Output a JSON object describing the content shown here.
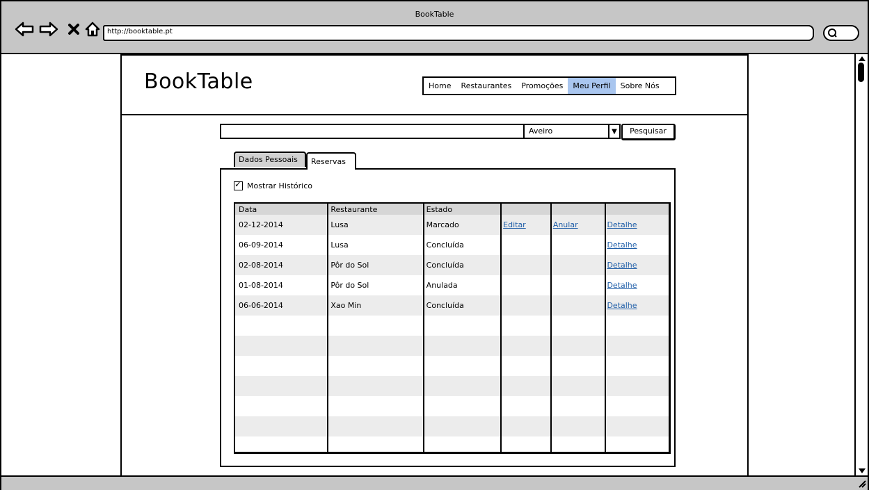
{
  "browser": {
    "window_title": "BookTable",
    "url": "http://booktable.pt"
  },
  "header": {
    "logo": "BookTable",
    "nav": [
      "Home",
      "Restaurantes",
      "Promoções",
      "Meu Perfil",
      "Sobre Nós"
    ],
    "active_nav": "Meu Perfil"
  },
  "search": {
    "query": "",
    "city": "Aveiro",
    "button": "Pesquisar"
  },
  "tabs": [
    "Dados Pessoais",
    "Reservas"
  ],
  "active_tab": "Reservas",
  "history_checkbox": {
    "label": "Mostrar Histórico",
    "checked": true
  },
  "table": {
    "columns": [
      "Data",
      "Restaurante",
      "Estado",
      "",
      "",
      ""
    ],
    "rows": [
      [
        "02-12-2014",
        "Lusa",
        "Marcado",
        "Editar",
        "Anular",
        "Detalhe"
      ],
      [
        "06-09-2014",
        "Lusa",
        "Concluída",
        "",
        "",
        "Detalhe"
      ],
      [
        "02-08-2014",
        "Pôr do Sol",
        "Concluída",
        "",
        "",
        "Detalhe"
      ],
      [
        "01-08-2014",
        "Pôr do Sol",
        "Anulada",
        "",
        "",
        "Detalhe"
      ],
      [
        "06-06-2014",
        "Xao Min",
        "Concluída",
        "",
        "",
        "Detalhe"
      ]
    ],
    "empty_rows": 7
  },
  "colors": {
    "chrome": "#c6c6c6",
    "nav_active": "#a9c6ef",
    "link": "#1f5ea8",
    "row_alt": "#ececec",
    "header_row": "#d6d6d6"
  }
}
